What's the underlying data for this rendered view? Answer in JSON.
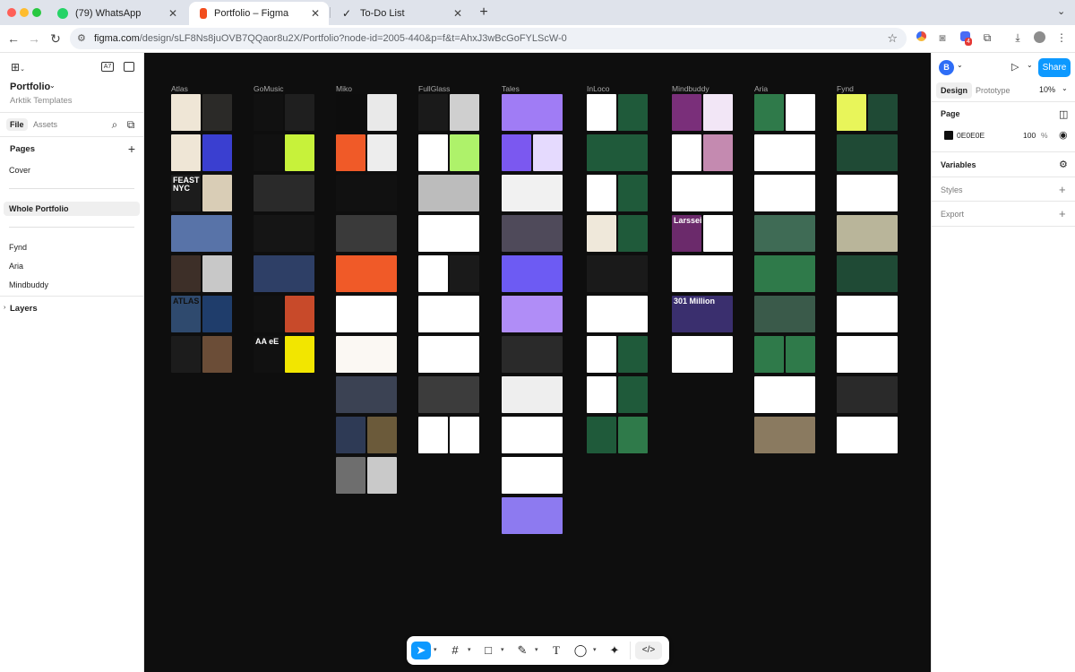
{
  "browser": {
    "tabs": [
      {
        "title": "(79) WhatsApp",
        "favicon_color": "#25d366"
      },
      {
        "title": "Portfolio – Figma",
        "favicon_color": "#f24e1e"
      },
      {
        "title": "To-Do List",
        "favicon_color": "#333333"
      }
    ],
    "url_host": "figma.com",
    "url_path": "/design/sLF8Ns8juOVB7QQaor8u2X/Portfolio?node-id=2005-440&p=f&t=AhxJ3wBcGoFYLScW-0",
    "extension_badge": "4"
  },
  "left_panel": {
    "file_name": "Portfolio",
    "team": "Arktik Templates",
    "tab_file": "File",
    "tab_assets": "Assets",
    "pages_heading": "Pages",
    "pages": [
      "Cover",
      "Whole Portfolio",
      "Fynd",
      "Aria",
      "Mindbuddy"
    ],
    "selected_page": "Whole Portfolio",
    "layers_heading": "Layers",
    "page_icon_text": "A7"
  },
  "canvas": {
    "background": "#0e0e0e",
    "columns": [
      {
        "label": "Atlas",
        "frames": [
          [
            "#efe6d6",
            "#2b2a28"
          ],
          [
            "#efe6d6",
            "#3a3fd0"
          ],
          [
            "#1c1c1c",
            "#d9cdb6"
          ],
          [
            "#5873a8"
          ],
          [
            "#3d2f28",
            "#c8c8c8"
          ],
          [
            "#2f4a6e",
            "#1f3d6b"
          ],
          [
            "#1c1c1c",
            "#6b4d37"
          ]
        ],
        "texts": {
          "2": "FEAST NYC",
          "5": "ATLAS"
        }
      },
      {
        "label": "GoMusic",
        "frames": [
          [
            "#111111",
            "#1f1f1f"
          ],
          [
            "#111111",
            "#c7f23a"
          ],
          [
            "#2a2a2a"
          ],
          [
            "#151515"
          ],
          [
            "#2e3f66"
          ],
          [
            "#111111",
            "#c84a2a"
          ],
          [
            "#111111",
            "#f2e600"
          ]
        ],
        "texts": {
          "6": "AA eE"
        }
      },
      {
        "label": "Miko",
        "frames": [
          [
            "#0d0d0d",
            "#e9e9e9"
          ],
          [
            "#f05a28",
            "#ededed"
          ],
          [
            "#111111"
          ],
          [
            "#3a3a3a"
          ],
          [
            "#f05a28"
          ],
          [
            "#ffffff"
          ],
          [
            "#fbf8f3"
          ],
          [
            "#3b4253"
          ],
          [
            "#2e3a55",
            "#6b5a3a"
          ],
          [
            "#6e6e6e",
            "#c9c9c9"
          ]
        ],
        "texts": {}
      },
      {
        "label": "FullGlass",
        "frames": [
          [
            "#1a1a1a",
            "#cfcfcf"
          ],
          [
            "#ffffff",
            "#aef26a"
          ],
          [
            "#bcbcbc"
          ],
          [
            "#ffffff"
          ],
          [
            "#ffffff",
            "#1a1a1a"
          ],
          [
            "#ffffff"
          ],
          [
            "#ffffff"
          ],
          [
            "#3c3c3c"
          ],
          [
            "#ffffff",
            "#ffffff"
          ]
        ],
        "texts": {}
      },
      {
        "label": "Tales",
        "frames": [
          [
            "#a07cf5"
          ],
          [
            "#7b58f0",
            "#e5dafe"
          ],
          [
            "#f1f1f1"
          ],
          [
            "#4f4a5a"
          ],
          [
            "#6d5bf3"
          ],
          [
            "#b08df7"
          ],
          [
            "#2a2a2a"
          ],
          [
            "#eeeeee"
          ],
          [
            "#ffffff"
          ],
          [
            "#ffffff"
          ],
          [
            "#8d7af0"
          ]
        ],
        "texts": {}
      },
      {
        "label": "InLoco",
        "frames": [
          [
            "#ffffff",
            "#1f5a3a"
          ],
          [
            "#1f5a3a"
          ],
          [
            "#ffffff",
            "#1f5a3a"
          ],
          [
            "#efe8da",
            "#1f5a3a"
          ],
          [
            "#1a1a1a"
          ],
          [
            "#ffffff"
          ],
          [
            "#ffffff",
            "#1f5a3a"
          ],
          [
            "#ffffff",
            "#1f5a3a"
          ],
          [
            "#1f5a3a",
            "#2f7a4a"
          ]
        ],
        "texts": {}
      },
      {
        "label": "Mindbuddy",
        "frames": [
          [
            "#7a2f7a",
            "#f2e6f6"
          ],
          [
            "#ffffff",
            "#c48ab0"
          ],
          [
            "#ffffff"
          ],
          [
            "#6b2a6b",
            "#ffffff"
          ],
          [
            "#ffffff"
          ],
          [
            "#3a2f6e"
          ],
          [
            "#ffffff"
          ]
        ],
        "texts": {
          "3": "Larsseit",
          "5": "301 Million"
        }
      },
      {
        "label": "Aria",
        "frames": [
          [
            "#2f7a4a",
            "#ffffff"
          ],
          [
            "#ffffff"
          ],
          [
            "#ffffff"
          ],
          [
            "#3f6b55"
          ],
          [
            "#2f7a4a"
          ],
          [
            "#3a5a4a"
          ],
          [
            "#2f7a4a",
            "#2f7a4a"
          ],
          [
            "#ffffff"
          ],
          [
            "#8a7a60"
          ]
        ],
        "texts": {}
      },
      {
        "label": "Fynd",
        "frames": [
          [
            "#e8f55a",
            "#1f4a35"
          ],
          [
            "#1f4a35"
          ],
          [
            "#ffffff"
          ],
          [
            "#b9b59a"
          ],
          [
            "#1f4a35"
          ],
          [
            "#ffffff"
          ],
          [
            "#ffffff"
          ],
          [
            "#2a2a2a"
          ],
          [
            "#ffffff"
          ]
        ],
        "texts": {}
      }
    ]
  },
  "toolbar": {
    "tools": [
      "move-icon",
      "frame-icon",
      "rectangle-icon",
      "pen-icon",
      "text-icon",
      "comment-icon",
      "actions-icon",
      "dev-mode-icon"
    ],
    "active_tool": "move-icon"
  },
  "right_panel": {
    "avatar_letter": "B",
    "share_label": "Share",
    "tab_design": "Design",
    "tab_prototype": "Prototype",
    "zoom": "10%",
    "page_heading": "Page",
    "page_color_hex": "0E0E0E",
    "page_opacity": "100",
    "percent": "%",
    "variables_heading": "Variables",
    "styles_heading": "Styles",
    "export_heading": "Export"
  },
  "help_label": "?"
}
